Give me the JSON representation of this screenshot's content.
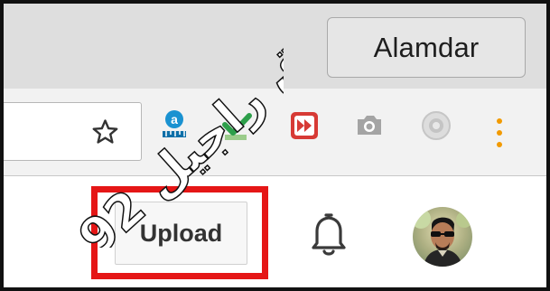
{
  "window": {
    "profile_name": "Alamdar"
  },
  "toolbar": {
    "icons": [
      "bookmark-star-icon",
      "amazon-assistant-extension-icon",
      "green-checkmark-extension-icon",
      "red-fast-forward-extension-icon",
      "camera-extension-icon",
      "gray-circle-extension-icon",
      "kebab-menu-icon"
    ]
  },
  "youtube_header": {
    "upload_label": "Upload",
    "notification_icon": "bell-icon",
    "avatar_icon": "user-avatar-icon"
  },
  "colors": {
    "title_bar": "#dedede",
    "toolbar": "#f2f2f2",
    "highlight": "#e51616",
    "menu_dots": "#f29a00"
  },
  "watermark": {
    "text": "فارق راجیل 92"
  }
}
